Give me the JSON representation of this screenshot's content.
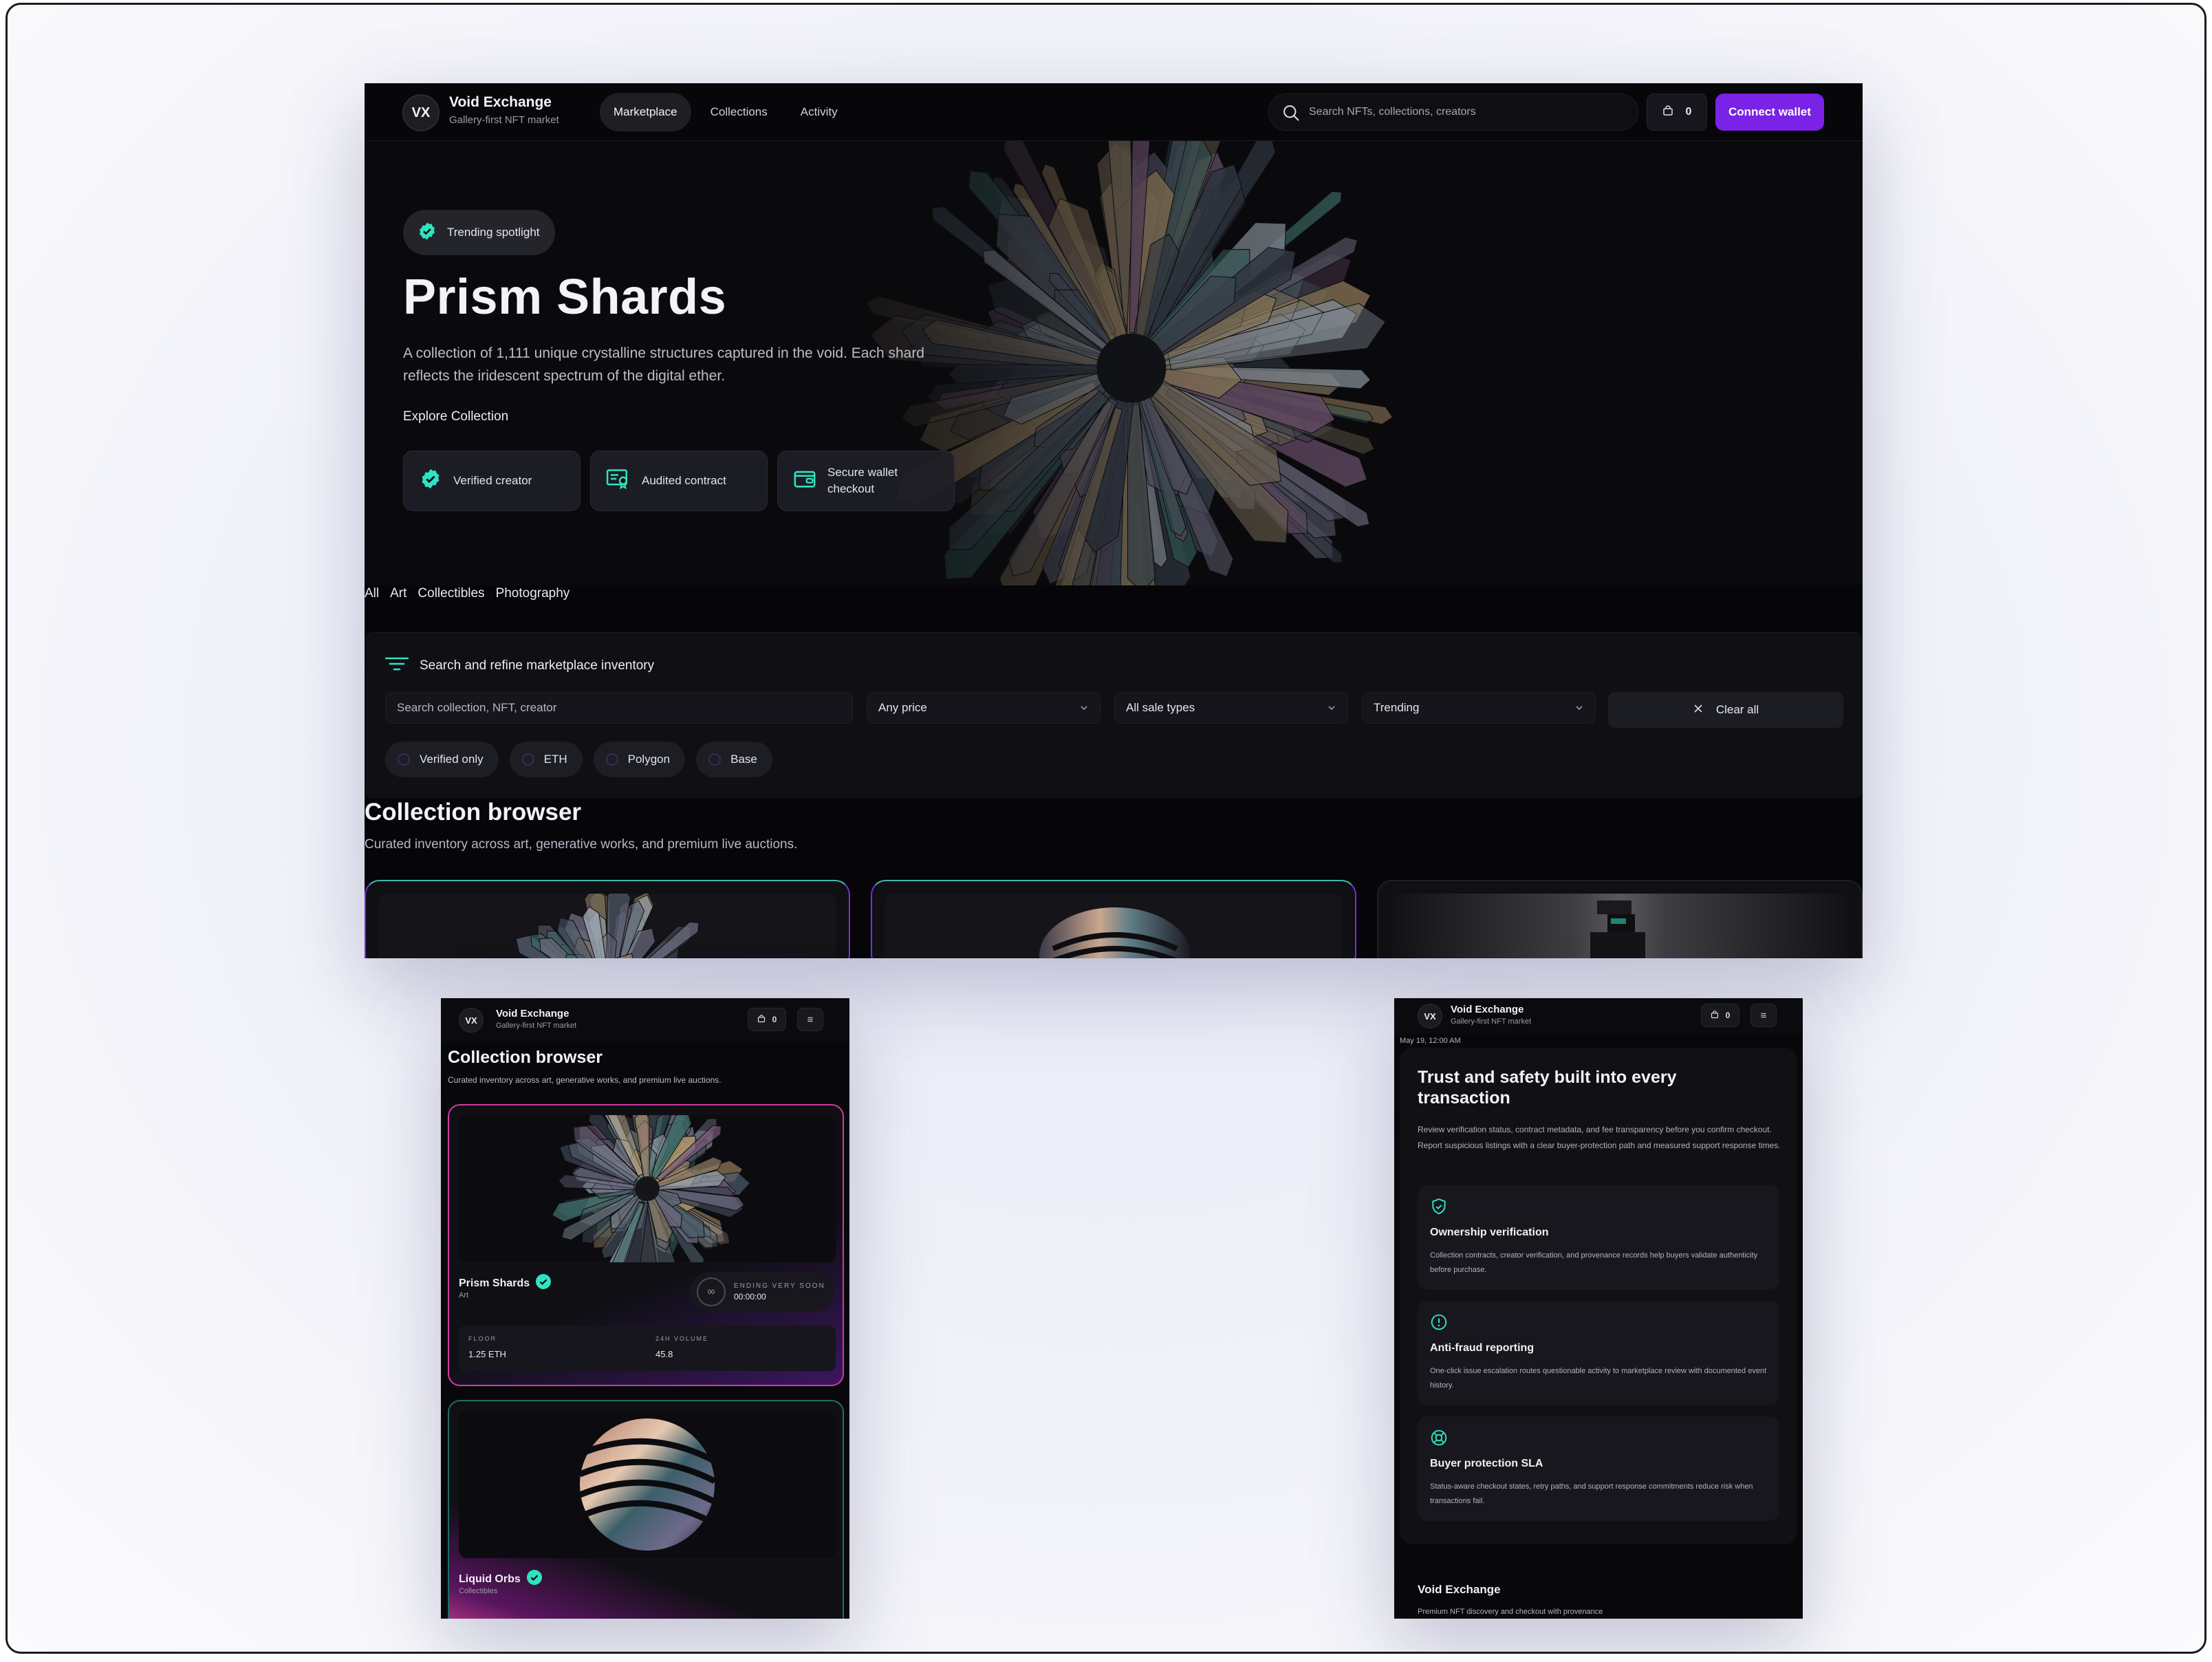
{
  "app": {
    "initials": "VX",
    "name": "Void Exchange",
    "tagline": "Gallery-first NFT market"
  },
  "nav": {
    "links": [
      "Marketplace",
      "Collections",
      "Activity"
    ],
    "active": "Marketplace",
    "search_placeholder": "Search NFTs, collections, creators",
    "cart_count": "0",
    "connect_label": "Connect wallet"
  },
  "hero": {
    "badge": "Trending spotlight",
    "title": "Prism Shards",
    "description": "A collection of 1,111 unique crystalline structures captured in the void. Each shard reflects the iridescent spectrum of the digital ether.",
    "cta": "Explore Collection",
    "trust": [
      {
        "icon": "verified-badge-icon",
        "label": "Verified creator"
      },
      {
        "icon": "audit-certificate-icon",
        "label": "Audited contract"
      },
      {
        "icon": "wallet-icon",
        "label": "Secure wallet checkout"
      }
    ]
  },
  "categories": [
    "All",
    "Art",
    "Collectibles",
    "Photography"
  ],
  "filters": {
    "title": "Search and refine marketplace inventory",
    "search_placeholder": "Search collection, NFT, creator",
    "price": "Any price",
    "sale_type": "All sale types",
    "sort": "Trending",
    "clear_label": "Clear all",
    "chips": [
      "Verified only",
      "ETH",
      "Polygon",
      "Base"
    ]
  },
  "browser": {
    "title": "Collection browser",
    "subtitle": "Curated inventory across art, generative works, and premium live auctions."
  },
  "cards": [
    {
      "name": "Prism Shards",
      "category": "Art",
      "verified": true,
      "timer_label": "ENDING VERY SOON",
      "timer_value": "00:00:00",
      "timer_glyph": "00",
      "floor_label": "FLOOR",
      "floor_value": "1.25 ETH",
      "volume_label": "24H VOLUME",
      "volume_value": "45.8"
    },
    {
      "name": "Liquid Orbs",
      "category": "Collectibles",
      "verified": true
    }
  ],
  "trust_section": {
    "timestamp": "May 19, 12:00 AM",
    "title": "Trust and safety built into every transaction",
    "description": "Review verification status, contract metadata, and fee transparency before you confirm checkout. Report suspicious listings with a clear buyer-protection path and measured support response times.",
    "features": [
      {
        "icon": "shield-check-icon",
        "title": "Ownership verification",
        "text": "Collection contracts, creator verification, and provenance records help buyers validate authenticity before purchase."
      },
      {
        "icon": "alert-circle-icon",
        "title": "Anti-fraud reporting",
        "text": "One-click issue escalation routes questionable activity to marketplace review with documented event history."
      },
      {
        "icon": "lifebuoy-icon",
        "title": "Buyer protection SLA",
        "text": "Status-aware checkout states, retry paths, and support response commitments reduce risk when transactions fail."
      }
    ]
  },
  "footer": {
    "name": "Void Exchange",
    "tagline": "Premium NFT discovery and checkout with provenance"
  },
  "colors": {
    "accent": "#7a22e6",
    "verified": "#2fe3c2",
    "background": "#060609"
  }
}
